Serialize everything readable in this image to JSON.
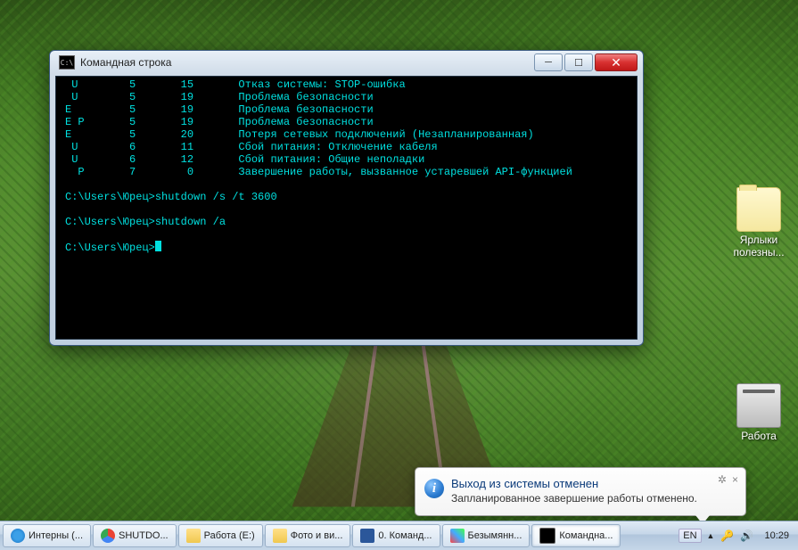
{
  "window": {
    "title": "Командная строка",
    "icon_abbr": "C:\\"
  },
  "terminal": {
    "rows": [
      {
        "c1": " U",
        "c2": "5",
        "c3": "15",
        "desc": "Отказ системы: STOP-ошибка"
      },
      {
        "c1": " U",
        "c2": "5",
        "c3": "19",
        "desc": "Проблема безопасности"
      },
      {
        "c1": "E",
        "c2": "5",
        "c3": "19",
        "desc": "Проблема безопасности"
      },
      {
        "c1": "E P",
        "c2": "5",
        "c3": "19",
        "desc": "Проблема безопасности"
      },
      {
        "c1": "E",
        "c2": "5",
        "c3": "20",
        "desc": "Потеря сетевых подключений (Незапланированная)"
      },
      {
        "c1": " U",
        "c2": "6",
        "c3": "11",
        "desc": "Сбой питания: Отключение кабеля"
      },
      {
        "c1": " U",
        "c2": "6",
        "c3": "12",
        "desc": "Сбой питания: Общие неполадки"
      },
      {
        "c1": "  P",
        "c2": "7",
        "c3": "0",
        "desc": "Завершение работы, вызванное устаревшей API-функцией"
      }
    ],
    "blank1": "",
    "prompt1_prefix": "C:\\Users\\Юрец>",
    "prompt1_cmd": "shutdown /s /t 3600",
    "blank2": "",
    "prompt2_prefix": "C:\\Users\\Юрец>",
    "prompt2_cmd": "shutdown /a",
    "blank3": "",
    "prompt3_prefix": "C:\\Users\\Юрец>",
    "prompt3_cmd": ""
  },
  "balloon": {
    "title": "Выход из системы отменен",
    "body": "Запланированное завершение работы отменено.",
    "gear": "✲",
    "close": "×"
  },
  "desktop_icons": {
    "shortcuts": {
      "label": "Ярлыки\nполезны..."
    },
    "work_drive": {
      "label": "Работа"
    }
  },
  "taskbar": {
    "items": [
      {
        "icon": "ie",
        "label": "Интерны (..."
      },
      {
        "icon": "chrome",
        "label": "SHUTDO..."
      },
      {
        "icon": "folder",
        "label": "Работа (E:)"
      },
      {
        "icon": "folder",
        "label": "Фото и ви..."
      },
      {
        "icon": "word",
        "label": "0. Команд..."
      },
      {
        "icon": "paint",
        "label": "Безымянн..."
      },
      {
        "icon": "cmd",
        "label": "Командна...",
        "active": true
      }
    ],
    "lang": "EN",
    "clock": "10:29"
  }
}
